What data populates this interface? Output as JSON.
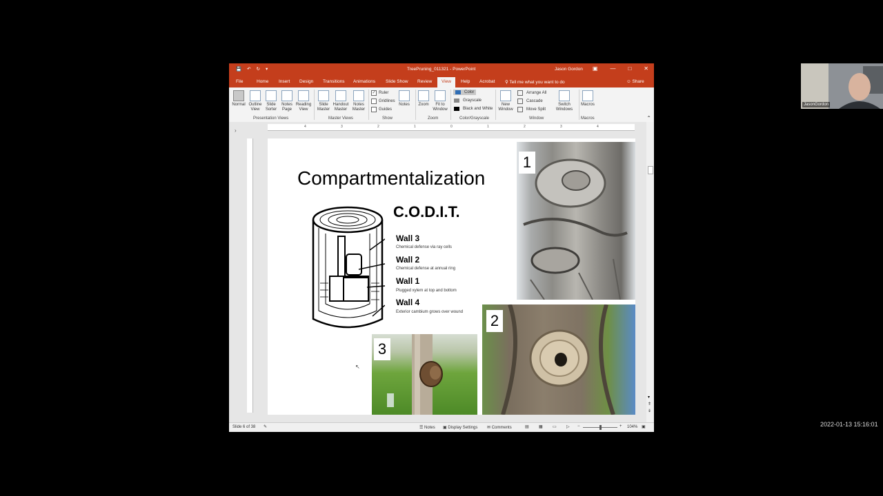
{
  "window": {
    "doc_title": "TreePruning_011321 - PowerPoint",
    "user": "Jason Gordon"
  },
  "tabs": [
    "File",
    "Home",
    "Insert",
    "Design",
    "Transitions",
    "Animations",
    "Slide Show",
    "Review",
    "View",
    "Help",
    "Acrobat"
  ],
  "active_tab": "View",
  "tell_me": "Tell me what you want to do",
  "share": "Share",
  "ribbon": {
    "presentation_views": {
      "label": "Presentation Views",
      "buttons": [
        "Normal",
        "Outline View",
        "Slide Sorter",
        "Notes Page",
        "Reading View"
      ]
    },
    "master_views": {
      "label": "Master Views",
      "buttons": [
        "Slide Master",
        "Handout Master",
        "Notes Master"
      ]
    },
    "show": {
      "label": "Show",
      "ruler": "Ruler",
      "gridlines": "Gridlines",
      "guides": "Guides",
      "notes": "Notes",
      "ruler_checked": true
    },
    "zoom": {
      "label": "Zoom",
      "zoom": "Zoom",
      "fit": "Fit to Window"
    },
    "color": {
      "label": "Color/Grayscale",
      "color": "Color",
      "grayscale": "Grayscale",
      "bw": "Black and White"
    },
    "window": {
      "label": "Window",
      "new": "New Window",
      "arrange": "Arrange All",
      "cascade": "Cascade",
      "move_split": "Move Split",
      "switch": "Switch Windows"
    },
    "macros": {
      "label": "Macros",
      "macros": "Macros"
    }
  },
  "ruler_numbers": [
    "4",
    "3",
    "2",
    "1",
    "0",
    "1",
    "2",
    "3",
    "4"
  ],
  "slide": {
    "title": "Compartmentalization",
    "subtitle": "C.O.D.I.T.",
    "walls": [
      {
        "name": "Wall 3",
        "desc": "Chemical defense via ray cells"
      },
      {
        "name": "Wall 2",
        "desc": "Chemical defense at annual ring"
      },
      {
        "name": "Wall 1",
        "desc": "Plugged xylem at top and bottom"
      },
      {
        "name": "Wall 4",
        "desc": "Exterior cambium grows over wound"
      }
    ],
    "photo_numbers": [
      "1",
      "2",
      "3"
    ]
  },
  "status": {
    "slide_count": "Slide 6 of 38",
    "notes": "Notes",
    "display_settings": "Display Settings",
    "comments": "Comments",
    "zoom": "104%"
  },
  "webcam": {
    "name": "JasonGordon"
  },
  "timestamp": "2022-01-13 15:16:01"
}
